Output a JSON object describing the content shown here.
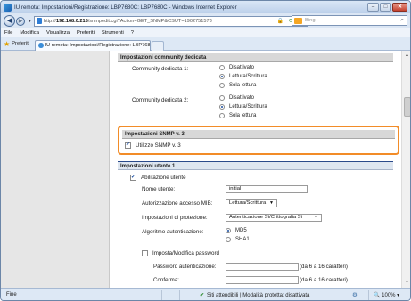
{
  "window": {
    "title": "IU remota: Impostazioni/Registrazione: LBP7680C: LBP7680C - Windows Internet Explorer",
    "min_label": "–",
    "max_label": "□",
    "close_label": "✕"
  },
  "address": {
    "back_glyph": "◀",
    "forward_glyph": "▶",
    "url_prefix": "http://",
    "url_host": "192.168.0.215",
    "url_path": "/snmpedit.cgi?Action=GET_SNMP&CSUT=1902751573",
    "search_placeholder": "Bing",
    "search_glyph": "⌕",
    "lock_glyph": "🔒",
    "refresh_glyph": "⟳",
    "stop_glyph": "✕"
  },
  "menu": [
    "File",
    "Modifica",
    "Visualizza",
    "Preferiti",
    "Strumenti",
    "?"
  ],
  "favorites": {
    "label": "Preferiti",
    "tab_title": "IU remota: Impostazioni/Registrazione: LBP7680C..."
  },
  "community": {
    "header": "Impostazioni community dedicata",
    "rows": [
      {
        "label": "Community dedicata 1:",
        "options": [
          "Disattivato",
          "Lettura/Scrittura",
          "Sola lettura"
        ],
        "selected": 1
      },
      {
        "label": "Community dedicata 2:",
        "options": [
          "Disattivato",
          "Lettura/Scrittura",
          "Sola lettura"
        ],
        "selected": 1
      }
    ]
  },
  "snmpv3": {
    "header": "Impostazioni SNMP v. 3",
    "checkbox_label": "Utilizzo SNMP v. 3",
    "checked": true
  },
  "user1": {
    "header": "Impostazioni utente 1",
    "enable_label": "Abilitazione utente",
    "enable_checked": true,
    "username_label": "Nome utente:",
    "username_value": "initial",
    "mib_label": "Autorizzazione accesso MIB:",
    "mib_value": "Lettura/Scrittura",
    "security_label": "Impostazioni di protezione:",
    "security_value": "Autenticazione Sì/Crittografia Sì",
    "algo_label": "Algoritmo autenticazione:",
    "algo_options": [
      "MD5",
      "SHA1"
    ],
    "algo_selected": 0,
    "password_check_label": "Imposta/Modifica password",
    "password_checked": false,
    "auth_pw_label": "Password autenticazione:",
    "auth_pw_hint": "(da 6 a 16 caratteri)",
    "confirm_label": "Conferma:",
    "confirm_hint": "(da 6 a 16 caratteri)"
  },
  "status": {
    "left": "Fine",
    "zone_check": "✔",
    "zone": "Siti attendibili | Modalità protetta: disattivata",
    "tool_glyph": "⚙",
    "zoom": "100%"
  },
  "colors": {
    "highlight_border": "#f28c28",
    "accent": "#1a4ea0"
  }
}
